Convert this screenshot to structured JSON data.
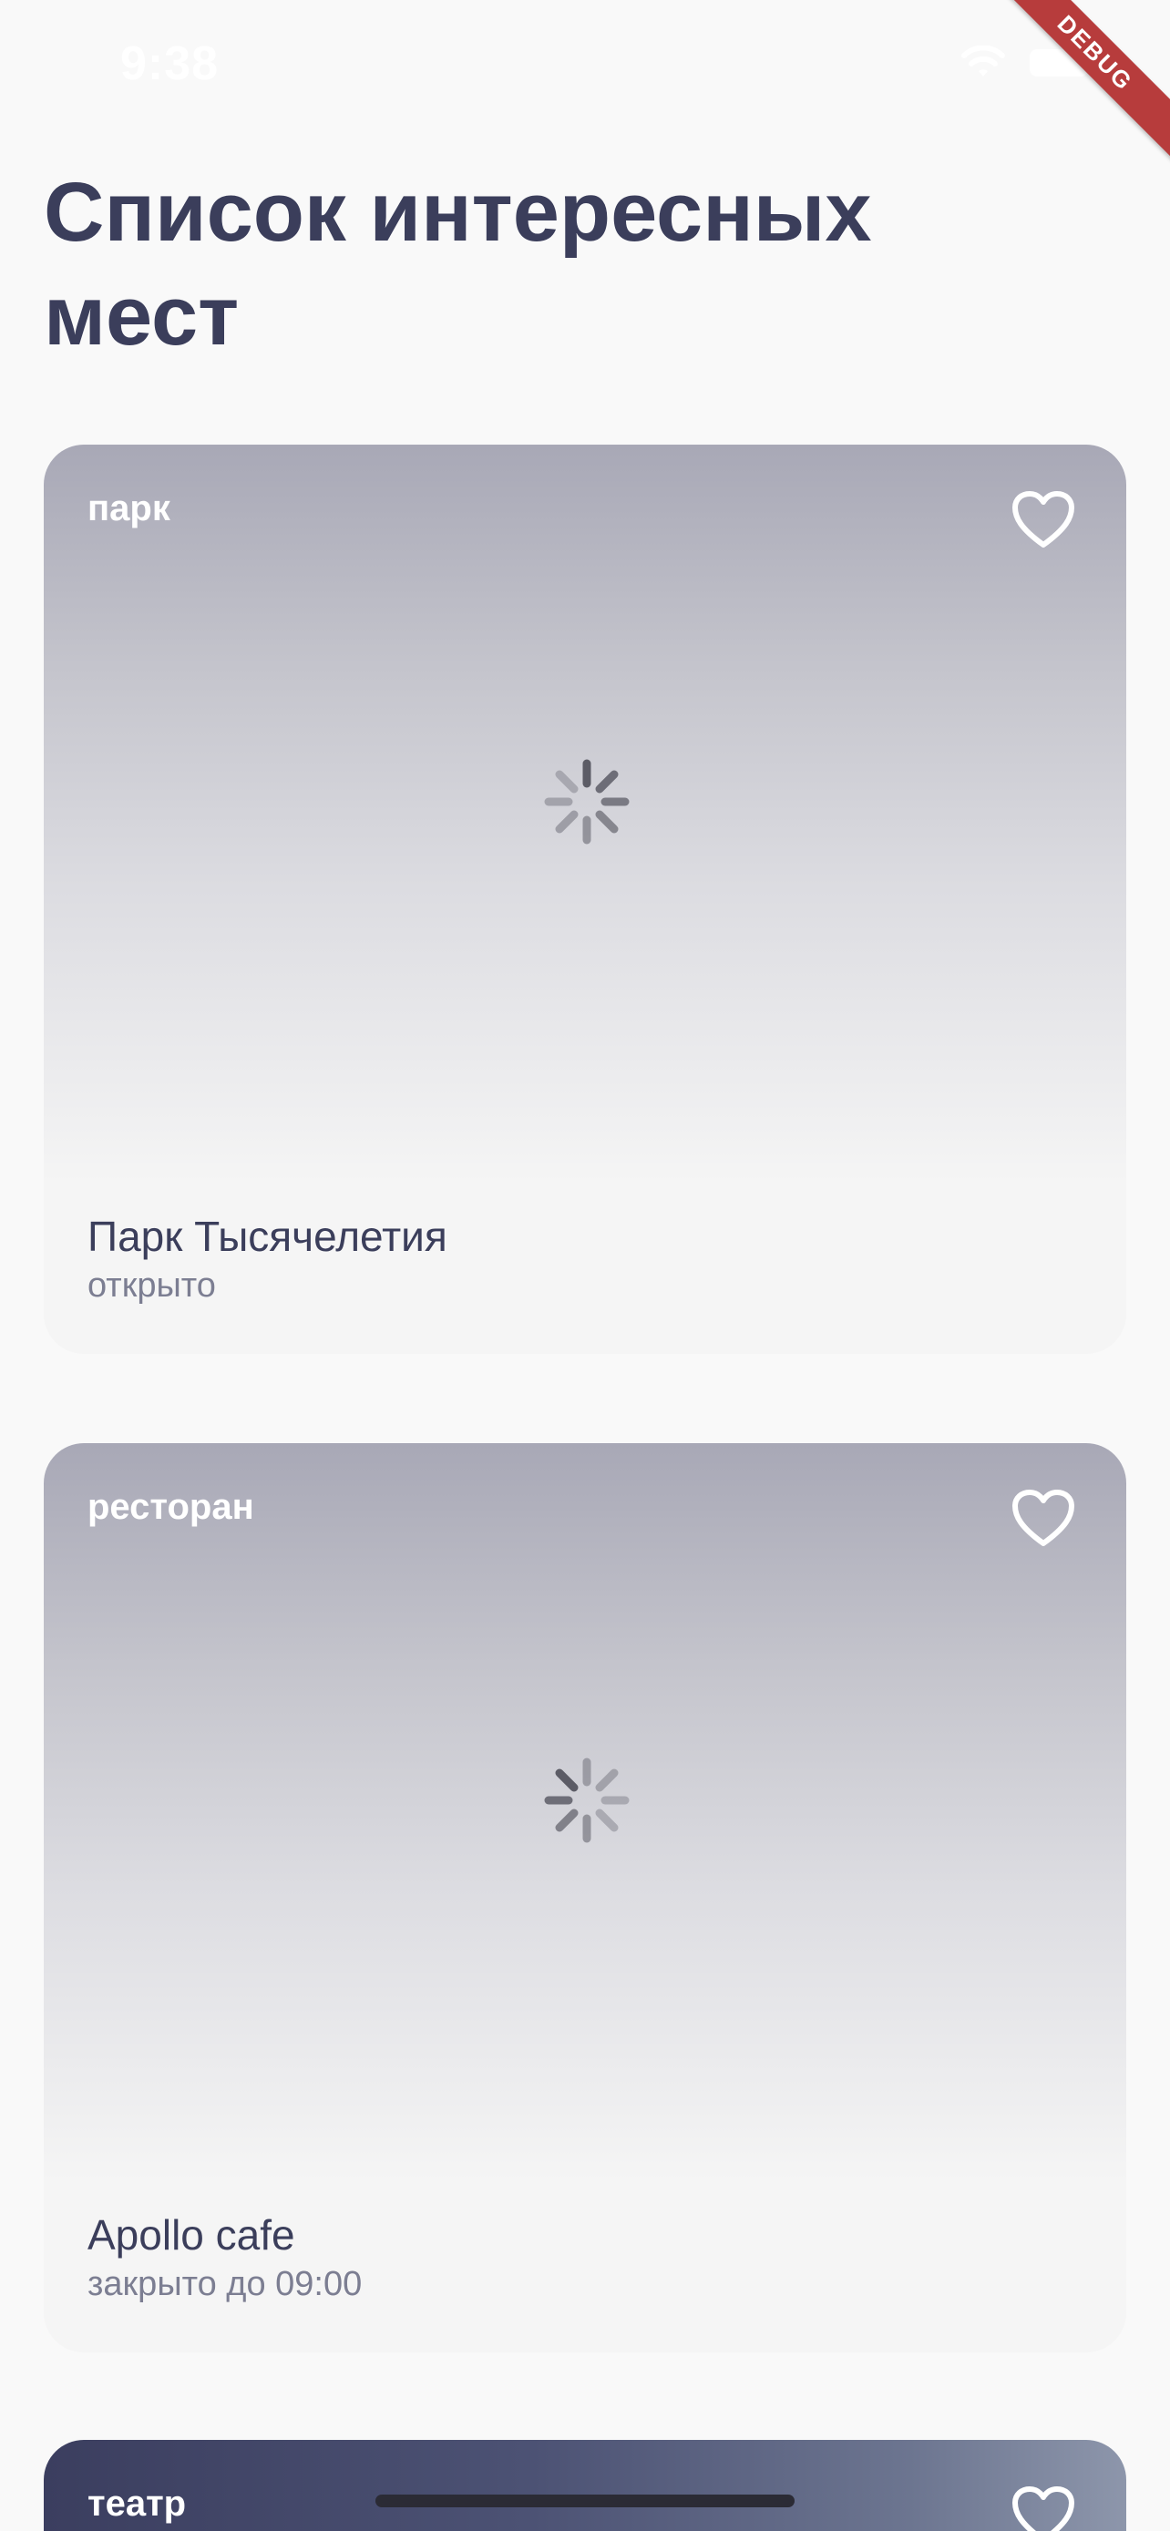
{
  "status_bar": {
    "time": "9:38",
    "wifi_icon": "wifi-icon",
    "battery_icon": "battery-icon"
  },
  "debug_banner": "DEBUG",
  "title": "Список интересных мест",
  "places": [
    {
      "type": "парк",
      "name": "Парк Тысячелетия",
      "status": "открыто",
      "favorite_icon": "heart-outline-icon",
      "loading_icon": "spinner-icon"
    },
    {
      "type": "ресторан",
      "name": "Apollo cafe",
      "status": "закрыто до 09:00",
      "favorite_icon": "heart-outline-icon",
      "loading_icon": "spinner-icon"
    },
    {
      "type": "театр",
      "favorite_icon": "heart-outline-icon"
    }
  ],
  "colors": {
    "title_text": "#3b3e5b",
    "secondary_text": "#7c7e92",
    "background": "#f9f9f9",
    "card_background": "#f5f5f5",
    "debug_ribbon": "#b73c3c"
  }
}
